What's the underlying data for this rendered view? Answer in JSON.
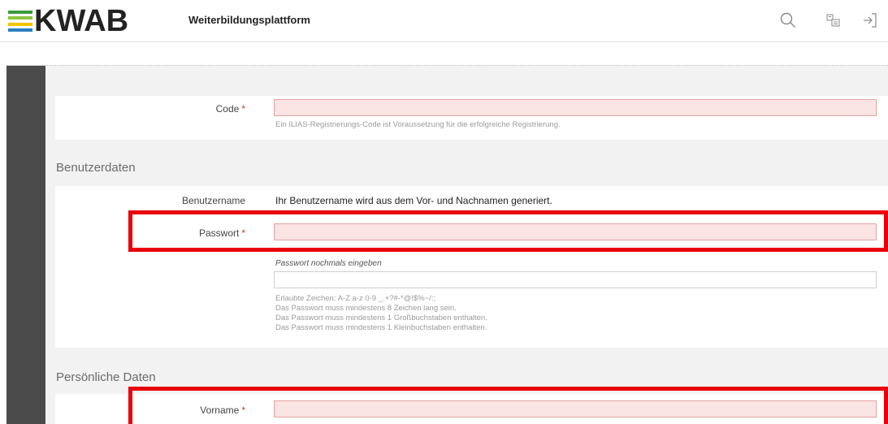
{
  "header": {
    "logo_text": "KWAB",
    "logo_colors": [
      "#3a9b3a",
      "#8cc63f",
      "#f2c500",
      "#2a7fc1"
    ],
    "site_title": "Weiterbildungsplattform",
    "icons": [
      "search-icon",
      "language-icon",
      "login-icon"
    ]
  },
  "form": {
    "code": {
      "label": "Code",
      "required_mark": "*",
      "help": "Ein ILIAS-Registrierungs-Code ist Voraussetzung für die erfolgreiche Registrierung."
    },
    "sections": {
      "user_data": "Benutzerdaten",
      "personal_data": "Persönliche Daten"
    },
    "username": {
      "label": "Benutzername",
      "value": "Ihr Benutzername wird aus dem Vor- und Nachnamen generiert."
    },
    "password": {
      "label": "Passwort",
      "required_mark": "*",
      "repeat_label": "Passwort nochmals eingeben",
      "help": [
        "Erlaubte Zeichen: A-Z a-z 0-9 _.+?#-*@!$%~/:;",
        "Das Passwort muss mindestens 8 Zeichen lang sein.",
        "Das Passwort muss mindestens 1 Großbuchstaben enthalten.",
        "Das Passwort muss mindestens 1 Kleinbuchstaben enthalten."
      ]
    },
    "firstname": {
      "label": "Vorname",
      "required_mark": "*"
    }
  },
  "colors": {
    "required_field_bg": "#fbe4e4",
    "required_mark": "#c8373a",
    "highlight": "#e8000b",
    "sidebar": "#4b4b4b"
  }
}
